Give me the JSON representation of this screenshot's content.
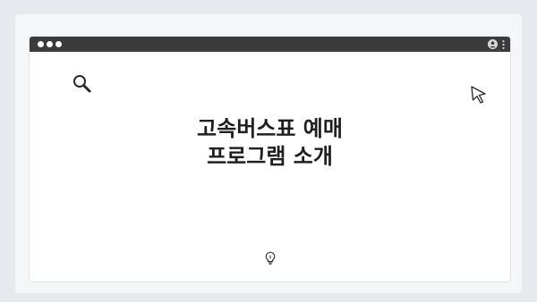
{
  "slide": {
    "headline_line1": "고속버스표 예매",
    "headline_line2": "프로그램 소개"
  },
  "icons": {
    "search": "search-icon",
    "cursor": "cursor-icon",
    "bulb": "lightbulb-icon",
    "user": "user-icon",
    "menu": "kebab-menu-icon"
  },
  "colors": {
    "titlebar": "#3b3b3b",
    "background": "#e6e9ee",
    "window": "#ffffff",
    "text": "#1f1f1f"
  }
}
